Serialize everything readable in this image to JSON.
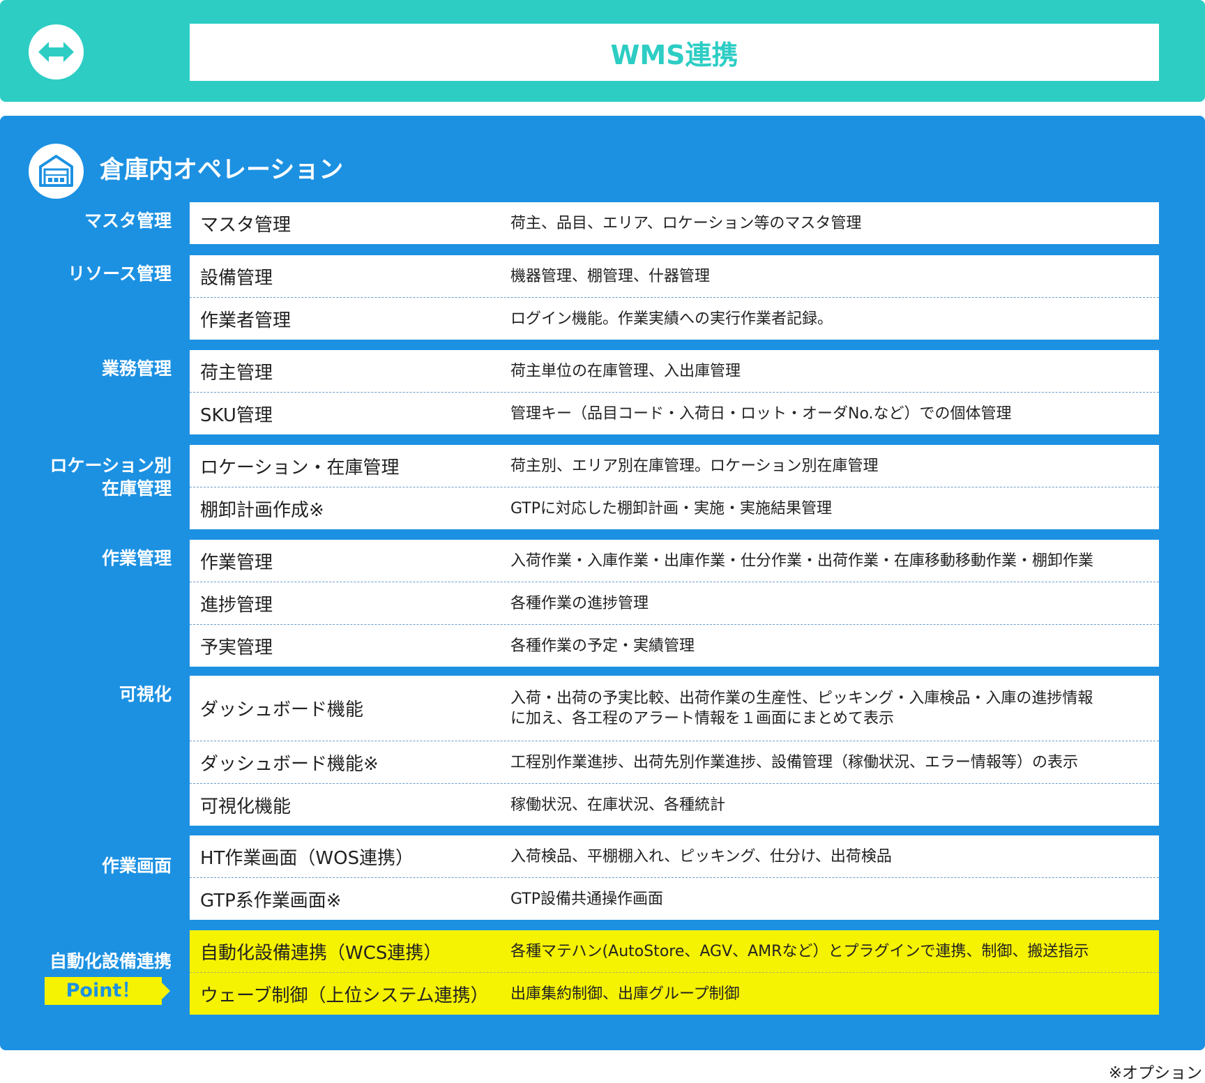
{
  "header": {
    "icon": "double-arrow-icon",
    "title": "WMS連携"
  },
  "section": {
    "icon": "warehouse-icon",
    "title": "倉庫内オペレーション"
  },
  "categories": [
    {
      "label": "マスタ管理",
      "rows": [
        {
          "feature": "マスタ管理",
          "description": "荷主、品目、エリア、ロケーション等のマスタ管理"
        }
      ]
    },
    {
      "label": "リソース管理",
      "rows": [
        {
          "feature": "設備管理",
          "description": "機器管理、棚管理、什器管理"
        },
        {
          "feature": "作業者管理",
          "description": "ログイン機能。作業実績への実行作業者記録。"
        }
      ]
    },
    {
      "label": "業務管理",
      "rows": [
        {
          "feature": "荷主管理",
          "description": "荷主単位の在庫管理、入出庫管理"
        },
        {
          "feature": "SKU管理",
          "description": "管理キー（品目コード・入荷日・ロット・オーダNo.など）での個体管理"
        }
      ]
    },
    {
      "label_lines": [
        "ロケーション別",
        "在庫管理"
      ],
      "rows": [
        {
          "feature": "ロケーション・在庫管理",
          "description": "荷主別、エリア別在庫管理。ロケーション別在庫管理"
        },
        {
          "feature": "棚卸計画作成※",
          "description": "GTPに対応した棚卸計画・実施・実施結果管理"
        }
      ]
    },
    {
      "label": "作業管理",
      "rows": [
        {
          "feature": "作業管理",
          "description": "入荷作業・入庫作業・出庫作業・仕分作業・出荷作業・在庫移動移動作業・棚卸作業"
        },
        {
          "feature": "進捗管理",
          "description": "各種作業の進捗管理"
        },
        {
          "feature": "予実管理",
          "description": "各種作業の予定・実績管理"
        }
      ]
    },
    {
      "label": "可視化",
      "rows": [
        {
          "feature": "ダッシュボード機能",
          "description_lines": [
            "入荷・出荷の予実比較、出荷作業の生産性、ピッキング・入庫検品・入庫の進捗情報",
            "に加え、各工程のアラート情報を１画面にまとめて表示"
          ]
        },
        {
          "feature": "ダッシュボード機能※",
          "description": "工程別作業進捗、出荷先別作業進捗、設備管理（稼働状況、エラー情報等）の表示"
        },
        {
          "feature": "可視化機能",
          "description": "稼働状況、在庫状況、各種統計"
        }
      ]
    },
    {
      "label": "作業画面",
      "rows": [
        {
          "feature": "HT作業画面（WOS連携）",
          "description": "入荷検品、平棚棚入れ、ピッキング、仕分け、出荷検品"
        },
        {
          "feature": "GTP系作業画面※",
          "description": "GTP設備共通操作画面"
        }
      ]
    },
    {
      "label": "自動化設備連携",
      "point_label": "Point！",
      "rows": [
        {
          "feature": "自動化設備連携（WCS連携）",
          "description": "各種マテハン(AutoStore、AGV、AMRなど）とプラグインで連携、制御、搬送指示"
        },
        {
          "feature": "ウェーブ制御（上位システム連携）",
          "description": "出庫集約制御、出庫グループ制御"
        }
      ]
    }
  ],
  "footnote": "※オプション",
  "colors": {
    "teal": "#2dcdc4",
    "blue": "#1c91e2",
    "highlight_yellow": "#f5f202",
    "white": "#ffffff"
  }
}
